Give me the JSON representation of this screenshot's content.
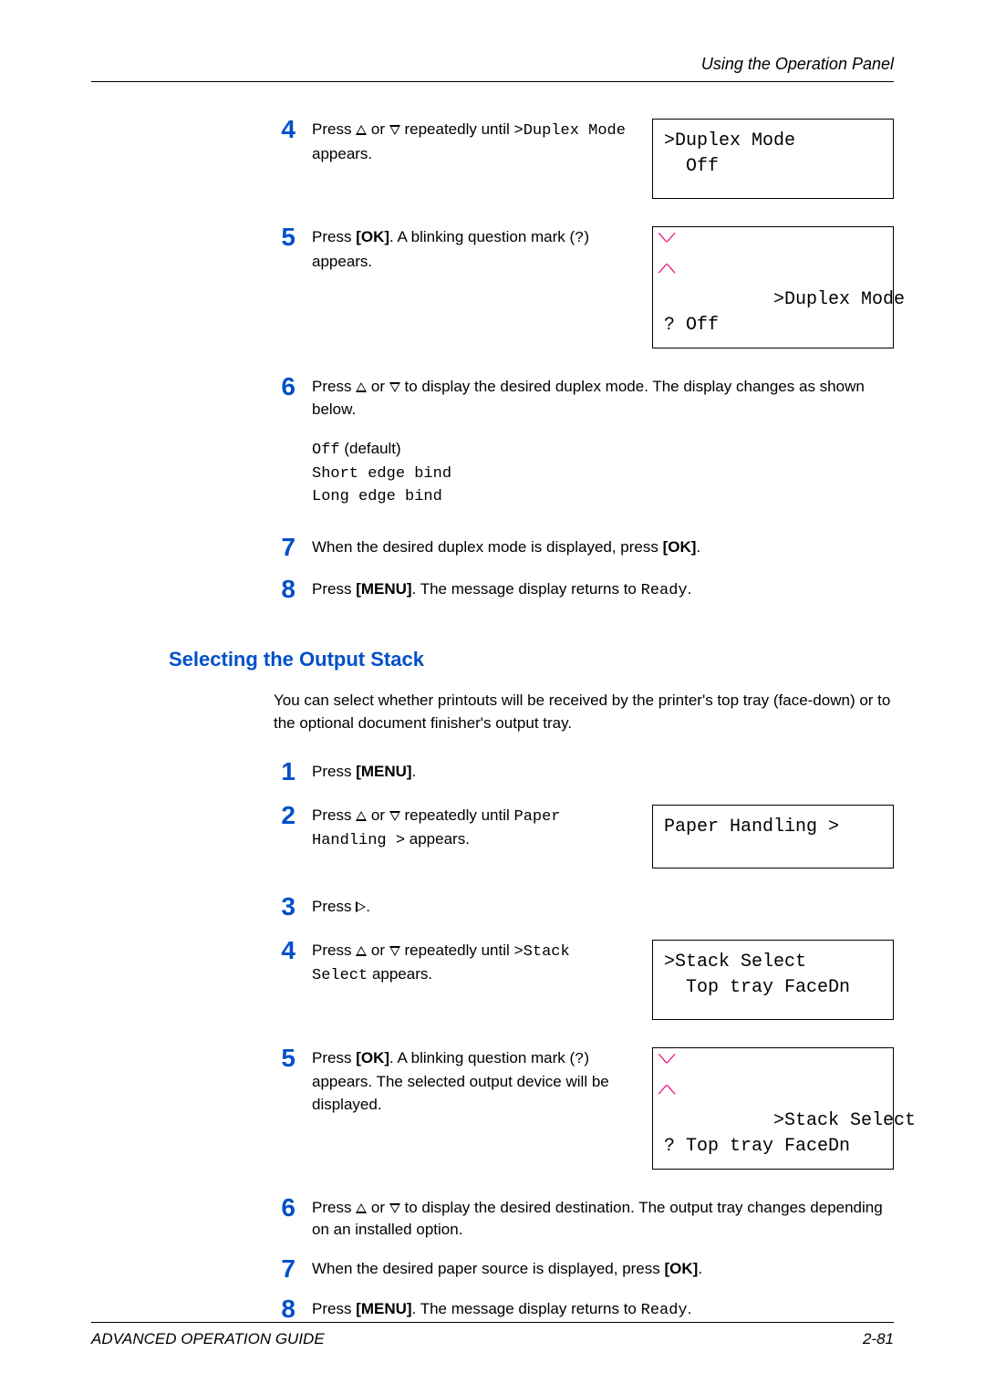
{
  "header": "Using the Operation Panel",
  "sectionA": {
    "steps": [
      {
        "num": "4",
        "pre": "Press ",
        "mid": " or ",
        "post1": " repeatedly until ",
        "mono1": ">Duplex Mode",
        "post2": " appears.",
        "lcd_line1": ">Duplex Mode",
        "lcd_line2": "  Off"
      },
      {
        "num": "5",
        "t1": "Press ",
        "bold1": "[OK]",
        "t2": ". A blinking question mark (",
        "mono1": "?",
        "t3": ") appears.",
        "lcd_line1": ">Duplex Mode",
        "lcd_line2": "? Off"
      },
      {
        "num": "6",
        "pre": "Press ",
        "mid": " or ",
        "post": " to display the desired duplex mode. The display changes as shown below.",
        "opt1_mono": "Off",
        "opt1_rest": " (default)",
        "opt2": "Short edge bind",
        "opt3": "Long edge bind"
      },
      {
        "num": "7",
        "t1": "When the desired duplex mode is displayed, press ",
        "bold1": "[OK]",
        "t2": "."
      },
      {
        "num": "8",
        "t1": "Press ",
        "bold1": "[MENU]",
        "t2": ". The message display returns to ",
        "mono1": "Ready",
        "t3": "."
      }
    ]
  },
  "sectionB": {
    "heading": "Selecting the Output Stack",
    "intro": "You can select whether printouts will be received by the printer's top tray (face-down) or to the optional document finisher's output tray.",
    "steps": [
      {
        "num": "1",
        "t1": "Press ",
        "bold1": "[MENU]",
        "t2": "."
      },
      {
        "num": "2",
        "pre": "Press ",
        "mid": " or ",
        "post1": " repeatedly until ",
        "mono1": "Paper Handling >",
        "post2": " appears.",
        "lcd_line1": "Paper Handling >"
      },
      {
        "num": "3",
        "pre": "Press ",
        "post": "."
      },
      {
        "num": "4",
        "pre": "Press ",
        "mid": " or ",
        "post1": " repeatedly until ",
        "mono1": ">Stack Select",
        "post2": " appears.",
        "lcd_line1": ">Stack Select",
        "lcd_line2": "  Top tray FaceDn"
      },
      {
        "num": "5",
        "t1": "Press ",
        "bold1": "[OK]",
        "t2": ". A blinking question mark (",
        "mono1": "?",
        "t3": ") appears. The selected output device will be displayed.",
        "lcd_line1": ">Stack Select",
        "lcd_line2": "? Top tray FaceDn"
      },
      {
        "num": "6",
        "pre": "Press ",
        "mid": " or ",
        "post": " to display the desired destination. The output tray changes depending on an installed option."
      },
      {
        "num": "7",
        "t1": "When the desired paper source is displayed, press ",
        "bold1": "[OK]",
        "t2": "."
      },
      {
        "num": "8",
        "t1": "Press ",
        "bold1": "[MENU]",
        "t2": ". The message display returns to ",
        "mono1": "Ready",
        "t3": "."
      }
    ]
  },
  "footer": {
    "left": "ADVANCED OPERATION GUIDE",
    "right": "2-81"
  }
}
